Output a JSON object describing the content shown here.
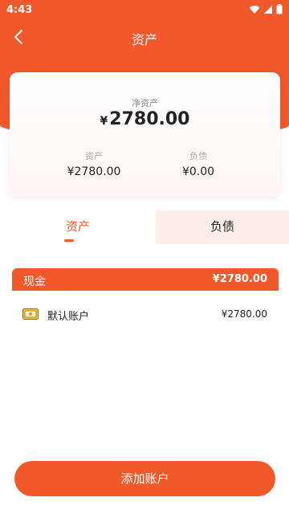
{
  "status_bar": {
    "time": "4:43"
  },
  "header": {
    "title": "资产"
  },
  "summary": {
    "net_label": "净资产",
    "currency_symbol": "¥",
    "net_value": "2780.00",
    "assets_label": "资产",
    "assets_value": "¥2780.00",
    "liabilities_label": "负债",
    "liabilities_value": "¥0.00"
  },
  "tabs": [
    {
      "label": "资产",
      "active": true
    },
    {
      "label": "负债",
      "active": false
    }
  ],
  "section": {
    "label": "现金",
    "amount": "¥2780.00"
  },
  "accounts": [
    {
      "name": "默认账户",
      "amount": "¥2780.00",
      "icon": "wallet-icon"
    }
  ],
  "actions": {
    "add_account_label": "添加账户"
  },
  "colors": {
    "accent": "#f2592a",
    "tab_inactive_bg": "#fbeee8"
  }
}
